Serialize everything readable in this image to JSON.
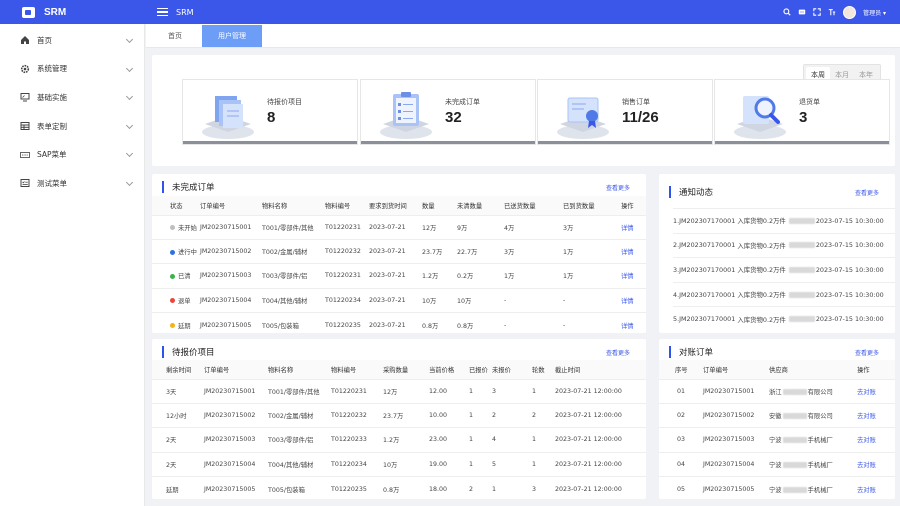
{
  "app": {
    "logo_text": "SRM",
    "system_name": "SRM",
    "user_name": "管理员 ▾"
  },
  "sidebar": {
    "items": [
      {
        "label": "首页",
        "icon": "home-icon"
      },
      {
        "label": "系统管理",
        "icon": "gear-icon"
      },
      {
        "label": "基础实施",
        "icon": "monitor-icon"
      },
      {
        "label": "表单定制",
        "icon": "table-icon"
      },
      {
        "label": "SAP菜单",
        "icon": "sap-icon"
      },
      {
        "label": "测试菜单",
        "icon": "checklist-icon"
      }
    ]
  },
  "tabs": [
    {
      "label": "首页",
      "active": false
    },
    {
      "label": "用户管理",
      "active": true
    }
  ],
  "period": {
    "options": [
      "本周",
      "本月",
      "本年"
    ],
    "selected": "本周"
  },
  "stats": [
    {
      "label": "待报价项目",
      "value": "8"
    },
    {
      "label": "未完成订单",
      "value": "32"
    },
    {
      "label": "销售订单",
      "value": "11/26"
    },
    {
      "label": "退货单",
      "value": "3"
    }
  ],
  "unfinished_orders": {
    "title": "未完成订单",
    "more": "查看更多",
    "columns": [
      "状态",
      "订单编号",
      "物料名称",
      "物料编号",
      "要求到货时间",
      "数量",
      "未清数量",
      "已送货数量",
      "已到货数量",
      "操作"
    ],
    "rows": [
      {
        "status": "未开始",
        "status_color": "#bfbfbf",
        "order": "JM20230715001",
        "material": "T001/零部件/其他",
        "code": "T01220231",
        "date": "2023-07-21",
        "qty": "12万",
        "open": "9万",
        "sent": "4万",
        "arrived": "3万",
        "action": "详情"
      },
      {
        "status": "进行中",
        "status_color": "#2f6fe4",
        "order": "JM20230715002",
        "material": "T002/金属/辅材",
        "code": "T01220232",
        "date": "2023-07-21",
        "qty": "23.7万",
        "open": "22.7万",
        "sent": "3万",
        "arrived": "1万",
        "action": "详情"
      },
      {
        "status": "已清",
        "status_color": "#3bb34a",
        "order": "JM20230715003",
        "material": "T003/零部件/铝",
        "code": "T01220231",
        "date": "2023-07-21",
        "qty": "1.2万",
        "open": "0.2万",
        "sent": "1万",
        "arrived": "1万",
        "action": "详情"
      },
      {
        "status": "退单",
        "status_color": "#e8473d",
        "order": "JM20230715004",
        "material": "T004/其他/辅材",
        "code": "T01220234",
        "date": "2023-07-21",
        "qty": "10万",
        "open": "10万",
        "sent": "-",
        "arrived": "-",
        "action": "详情"
      },
      {
        "status": "延期",
        "status_color": "#f5b316",
        "order": "JM20230715005",
        "material": "T005/包装箱",
        "code": "T01220235",
        "date": "2023-07-21",
        "qty": "0.8万",
        "open": "0.8万",
        "sent": "-",
        "arrived": "-",
        "action": "详情"
      }
    ]
  },
  "notices": {
    "title": "通知动态",
    "more": "查看更多",
    "items": [
      {
        "index": "1.",
        "order": "JM202307170001",
        "text": "入库货物0.2万件",
        "time": "2023-07-15 10:30:00"
      },
      {
        "index": "2.",
        "order": "JM202307170001",
        "text": "入库货物0.2万件",
        "time": "2023-07-15 10:30:00"
      },
      {
        "index": "3.",
        "order": "JM202307170001",
        "text": "入库货物0.2万件",
        "time": "2023-07-15 10:30:00"
      },
      {
        "index": "4.",
        "order": "JM202307170001",
        "text": "入库货物0.2万件",
        "time": "2023-07-15 10:30:00"
      },
      {
        "index": "5.",
        "order": "JM202307170001",
        "text": "入库货物0.2万件",
        "time": "2023-07-15 10:30:00"
      }
    ]
  },
  "quotes": {
    "title": "待报价项目",
    "more": "查看更多",
    "columns": [
      "剩余时间",
      "订单编号",
      "物料名称",
      "物料编号",
      "采购数量",
      "当前价格",
      "已报价",
      "未报价",
      "轮数",
      "截止时间"
    ],
    "rows": [
      {
        "remain": "3天",
        "order": "JM20230715001",
        "material": "T001/零部件/其他",
        "code": "T01220231",
        "qty": "12万",
        "price": "12.00",
        "quoted": "1",
        "unquoted": "3",
        "rounds": "1",
        "deadline": "2023-07-21 12:00:00"
      },
      {
        "remain": "12小时",
        "order": "JM20230715002",
        "material": "T002/金属/辅材",
        "code": "T01220232",
        "qty": "23.7万",
        "price": "10.00",
        "quoted": "1",
        "unquoted": "2",
        "rounds": "2",
        "deadline": "2023-07-21 12:00:00"
      },
      {
        "remain": "2天",
        "order": "JM20230715003",
        "material": "T003/零部件/铝",
        "code": "T01220233",
        "qty": "1.2万",
        "price": "23.00",
        "quoted": "1",
        "unquoted": "4",
        "rounds": "1",
        "deadline": "2023-07-21 12:00:00"
      },
      {
        "remain": "2天",
        "order": "JM20230715004",
        "material": "T004/其他/辅材",
        "code": "T01220234",
        "qty": "10万",
        "price": "19.00",
        "quoted": "1",
        "unquoted": "5",
        "rounds": "1",
        "deadline": "2023-07-21 12:00:00"
      },
      {
        "remain": "延期",
        "order": "JM20230715005",
        "material": "T005/包装箱",
        "code": "T01220235",
        "qty": "0.8万",
        "price": "18.00",
        "quoted": "2",
        "unquoted": "1",
        "rounds": "3",
        "deadline": "2023-07-21 12:00:00"
      }
    ]
  },
  "reconcile": {
    "title": "对账订单",
    "more": "查看更多",
    "columns": [
      "序号",
      "订单编号",
      "供应商",
      "操作"
    ],
    "rows": [
      {
        "no": "01",
        "order": "JM20230715001",
        "sup_a": "浙江",
        "sup_b": "有限公司",
        "action": "去对账"
      },
      {
        "no": "02",
        "order": "JM20230715002",
        "sup_a": "安徽",
        "sup_b": "有限公司",
        "action": "去对账"
      },
      {
        "no": "03",
        "order": "JM20230715003",
        "sup_a": "宁波",
        "sup_b": "手机械厂",
        "action": "去对账"
      },
      {
        "no": "04",
        "order": "JM20230715004",
        "sup_a": "宁波",
        "sup_b": "手机械厂",
        "action": "去对账"
      },
      {
        "no": "05",
        "order": "JM20230715005",
        "sup_a": "宁波",
        "sup_b": "手机械厂",
        "action": "去对账"
      }
    ]
  }
}
